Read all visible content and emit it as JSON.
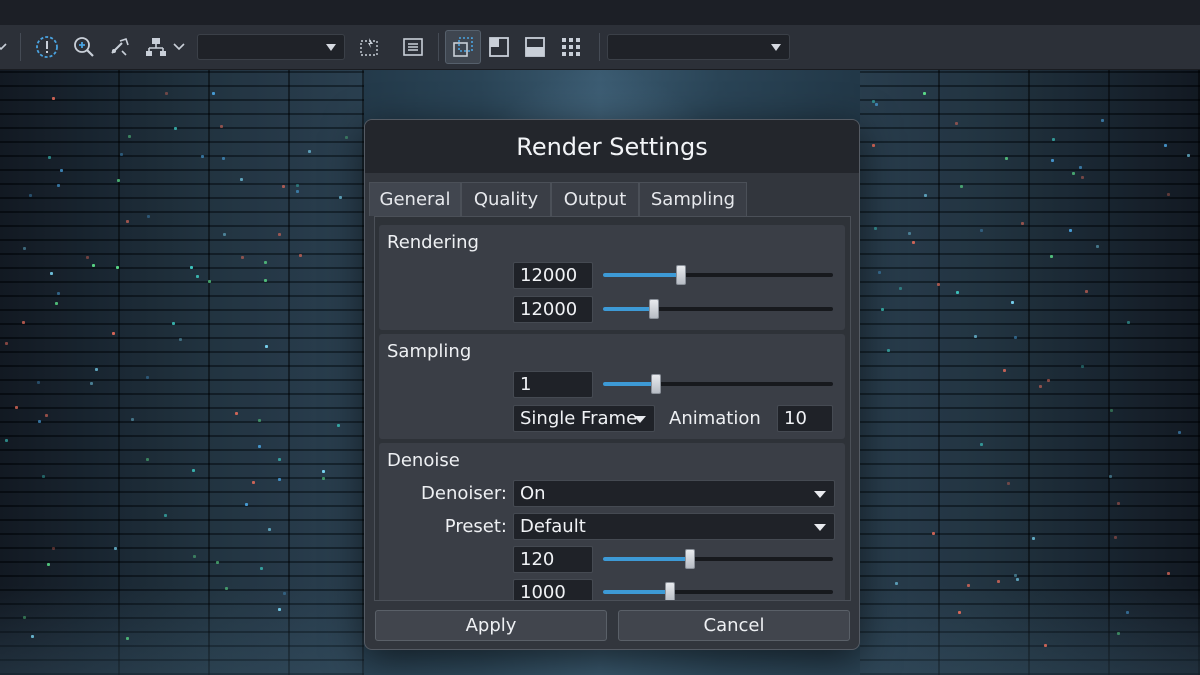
{
  "dialog": {
    "title": "Render Settings",
    "tabs": [
      {
        "label": "General",
        "active": true
      },
      {
        "label": "Quality",
        "active": false
      },
      {
        "label": "Output",
        "active": false
      },
      {
        "label": "Sampling",
        "active": false
      }
    ],
    "rendering": {
      "title": "Rendering",
      "field1": {
        "value": "12000",
        "slider_fraction": 0.34
      },
      "field2": {
        "value": "12000",
        "slider_fraction": 0.22
      }
    },
    "sampling": {
      "title": "Sampling",
      "field1": {
        "value": "1",
        "slider_fraction": 0.23
      },
      "mode": "Single Frame",
      "animation_label": "Animation",
      "animation_value": "10"
    },
    "denoise": {
      "title": "Denoise",
      "denoiser_label": "Denoiser:",
      "denoiser_value": "On",
      "preset_label": "Preset:",
      "preset_value": "Default",
      "field1": {
        "value": "120",
        "slider_fraction": 0.38
      },
      "field2": {
        "value": "1000",
        "slider_fraction": 0.29
      }
    },
    "apply_label": "Apply",
    "cancel_label": "Cancel"
  },
  "toolbar": {
    "icons": [
      "chevron-down-icon",
      "info-circle-icon",
      "zoom-in-icon",
      "transform-tool-icon",
      "tree-view-icon",
      "select-lasso-icon",
      "list-align-icon",
      "layout-split-icon",
      "layout-left-icon",
      "layout-bottom-icon",
      "grid-icon"
    ],
    "accent": "#3d9ad6"
  }
}
